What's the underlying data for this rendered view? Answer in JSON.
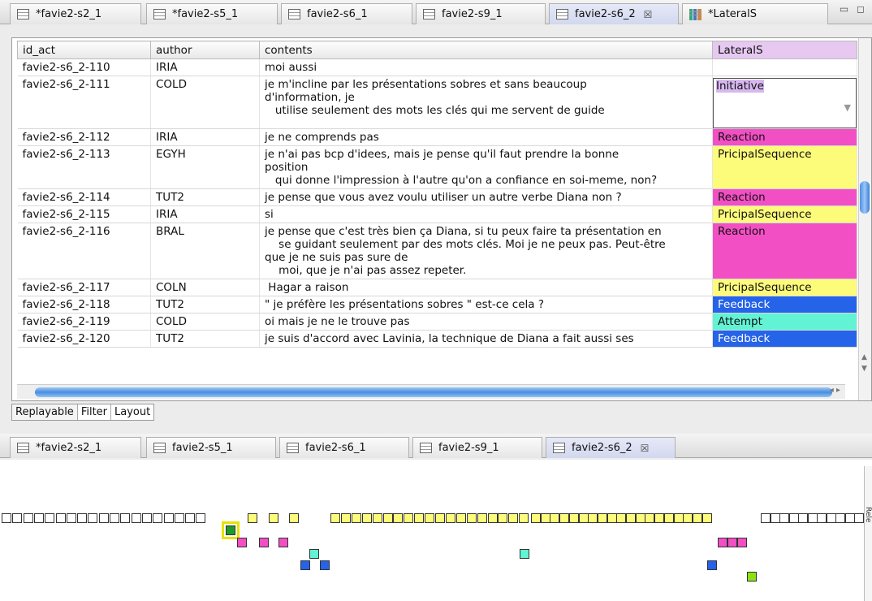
{
  "top_tabs": [
    {
      "label": "*favie2-s2_1",
      "active": false
    },
    {
      "label": "*favie2-s5_1",
      "active": false
    },
    {
      "label": "favie2-s6_1",
      "active": false
    },
    {
      "label": "favie2-s9_1",
      "active": false
    },
    {
      "label": "favie2-s6_2",
      "active": true,
      "close": "☒"
    },
    {
      "label": "*LateralS",
      "active": false,
      "icon": "grid"
    }
  ],
  "table": {
    "headers": {
      "id": "id_act",
      "author": "author",
      "contents": "contents",
      "lateral": "LateralS"
    },
    "rows": [
      {
        "id": "favie2-s6_2-110",
        "author": "IRIA",
        "contents": "moi aussi",
        "lateral": "",
        "color": "#ffffff"
      },
      {
        "id": "favie2-s6_2-111",
        "author": "COLD",
        "contents": "je m'incline par les présentations sobres et sans beaucoup\nd'information, je\n   utilise seulement des mots les clés qui me servent de guide",
        "lateral": "Initiative",
        "color": "#ffffff",
        "editing": true
      },
      {
        "id": "favie2-s6_2-112",
        "author": "IRIA",
        "contents": "je ne comprends pas",
        "lateral": "Reaction",
        "color": "#f24fc4"
      },
      {
        "id": "favie2-s6_2-113",
        "author": "EGYH",
        "contents": "je n'ai pas bcp d'idees, mais je pense qu'il faut prendre la bonne\nposition\n   qui donne l'impression à l'autre qu'on a confiance en soi-meme, non?",
        "lateral": "PricipalSequence",
        "color": "#fdfb7a"
      },
      {
        "id": "favie2-s6_2-114",
        "author": "TUT2",
        "contents": "je pense que vous avez voulu utiliser un autre verbe Diana non ?",
        "lateral": "Reaction",
        "color": "#f24fc4"
      },
      {
        "id": "favie2-s6_2-115",
        "author": "IRIA",
        "contents": "si",
        "lateral": "PricipalSequence",
        "color": "#fdfb7a"
      },
      {
        "id": "favie2-s6_2-116",
        "author": "BRAL",
        "contents": "je pense que c'est très bien ça Diana, si tu peux faire ta présentation en\n    se guidant seulement par des mots clés. Moi je ne peux pas. Peut-être\nque je ne suis pas sure de\n    moi, que je n'ai pas assez repeter.",
        "lateral": "Reaction",
        "color": "#f24fc4"
      },
      {
        "id": "favie2-s6_2-117",
        "author": "COLN",
        "contents": " Hagar a raison",
        "lateral": "PricipalSequence",
        "color": "#fdfb7a"
      },
      {
        "id": "favie2-s6_2-118",
        "author": "TUT2",
        "contents": "\" je préfère les présentations sobres \" est-ce cela ?",
        "lateral": "Feedback",
        "color": "#2563e8"
      },
      {
        "id": "favie2-s6_2-119",
        "author": "COLD",
        "contents": "oi mais je ne le trouve pas",
        "lateral": "Attempt",
        "color": "#62f2d4"
      },
      {
        "id": "favie2-s6_2-120",
        "author": "TUT2",
        "contents": "je suis d'accord avec Lavinia, la technique de Diana a fait aussi ses",
        "lateral": "Feedback",
        "color": "#2563e8"
      }
    ]
  },
  "view_tabs": [
    "Replayable",
    "Filter",
    "Layout"
  ],
  "bottom_tabs": [
    {
      "label": "*favie2-s2_1",
      "active": false
    },
    {
      "label": "favie2-s5_1",
      "active": false
    },
    {
      "label": "favie2-s6_1",
      "active": false
    },
    {
      "label": "favie2-s9_1",
      "active": false
    },
    {
      "label": "favie2-s6_2",
      "active": true,
      "close": "☒"
    }
  ],
  "timeline": {
    "colors": {
      "empty": "#ffffff",
      "principal": "#fdfb7a",
      "reaction": "#f24fc4",
      "attempt": "#62f2d4",
      "feedback": "#2563e8",
      "initiative": "#1f9a2a",
      "other": "#8ee015"
    },
    "rows": [
      {
        "type": "empty",
        "count": 19
      },
      {
        "type": "principal",
        "count": 3
      },
      {
        "type": "principal",
        "count": 19
      },
      {
        "type": "principal",
        "count": 19
      },
      {
        "type": "empty",
        "count": 11
      }
    ],
    "side_label": "Rele"
  }
}
